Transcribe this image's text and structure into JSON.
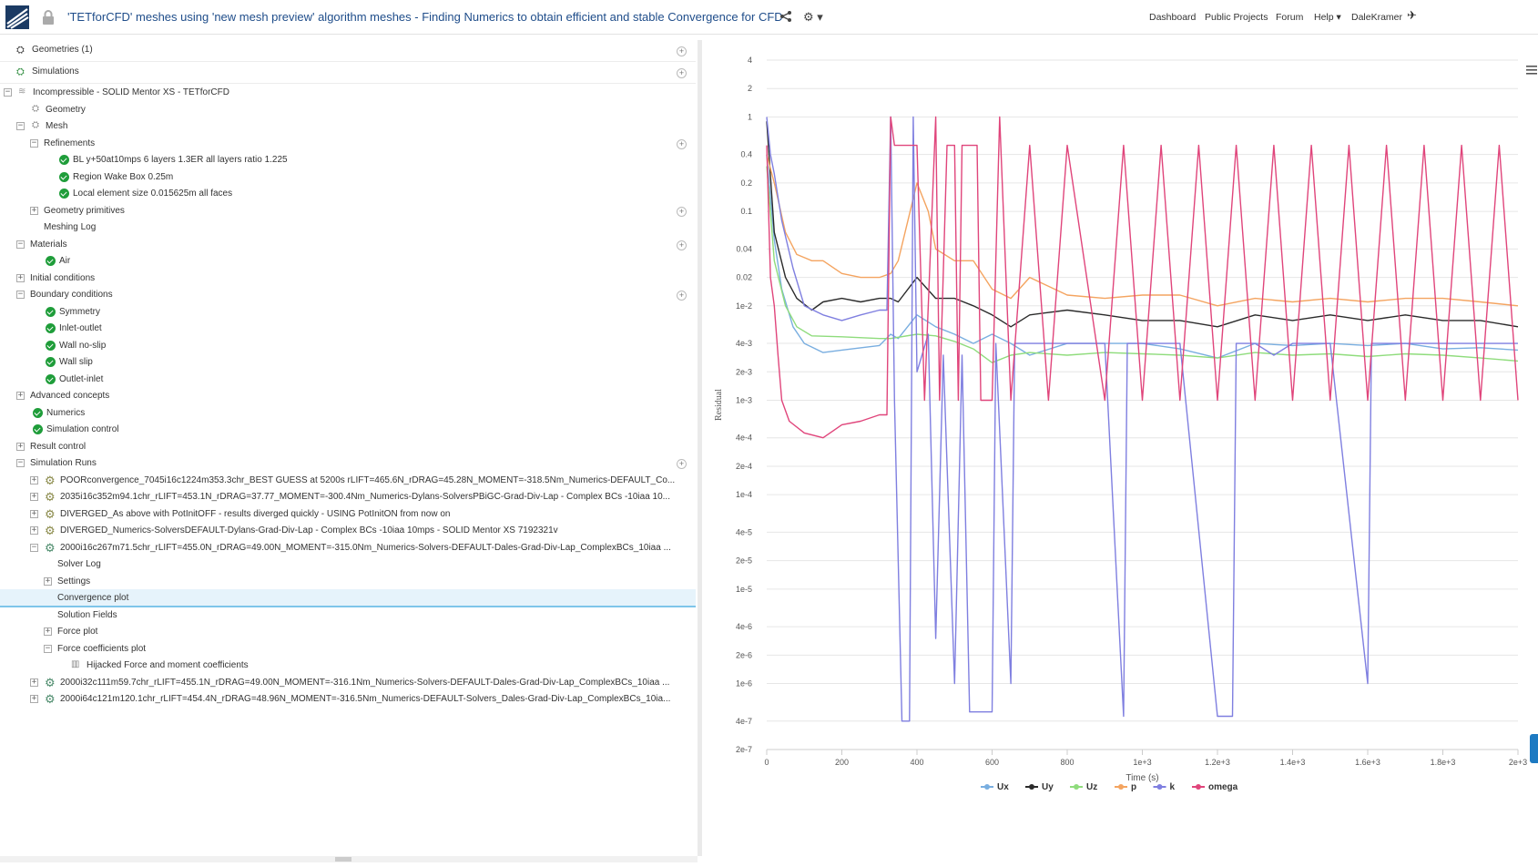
{
  "header": {
    "title": "'TETforCFD' meshes using 'new mesh preview' algorithm meshes - Finding Numerics to obtain efficient and stable Convergence for CFD",
    "nav": [
      "Dashboard",
      "Public Projects",
      "Forum",
      "Help",
      "DaleKramer"
    ]
  },
  "tree": {
    "geometries": "Geometries (1)",
    "simulations": "Simulations",
    "sim_name": "Incompressible - SOLID Mentor XS - TETforCFD",
    "geometry": "Geometry",
    "mesh": "Mesh",
    "refinements": "Refinements",
    "ref1": "BL y+50at10mps 6 layers 1.3ER all layers ratio 1.225",
    "ref2": "Region Wake Box 0.25m",
    "ref3": "Local element size 0.015625m all faces",
    "geom_prims": "Geometry primitives",
    "meshing_log": "Meshing Log",
    "materials": "Materials",
    "air": "Air",
    "initial": "Initial conditions",
    "boundary": "Boundary conditions",
    "bc1": "Symmetry",
    "bc2": "Inlet-outlet",
    "bc3": "Wall no-slip",
    "bc4": "Wall slip",
    "bc5": "Outlet-inlet",
    "advanced": "Advanced concepts",
    "numerics": "Numerics",
    "sim_control": "Simulation control",
    "result_control": "Result control",
    "sim_runs": "Simulation Runs",
    "run1": "POORconvergence_7045i16c1224m353.3chr_BEST GUESS at 5200s rLIFT=465.6N_rDRAG=45.28N_MOMENT=-318.5Nm_Numerics-DEFAULT_Co...",
    "run2": "2035i16c352m94.1chr_rLIFT=453.1N_rDRAG=37.77_MOMENT=-300.4Nm_Numerics-Dylans-SolversPBiGC-Grad-Div-Lap - Complex BCs -10iaa 10...",
    "run3": "DIVERGED_As above with PotInitOFF - results diverged quickly - USING PotInitON from now on",
    "run4": "DIVERGED_Numerics-SolversDEFAULT-Dylans-Grad-Div-Lap - Complex BCs -10iaa 10mps - SOLID Mentor XS 7192321v",
    "run5": "2000i16c267m71.5chr_rLIFT=455.0N_rDRAG=49.00N_MOMENT=-315.0Nm_Numerics-Solvers-DEFAULT-Dales-Grad-Div-Lap_ComplexBCs_10iaa ...",
    "solver_log": "Solver Log",
    "settings": "Settings",
    "conv_plot": "Convergence plot",
    "sol_fields": "Solution Fields",
    "force_plot": "Force plot",
    "force_coef": "Force coefficients plot",
    "hijacked": "Hijacked Force and moment coefficients",
    "run6": "2000i32c111m59.7chr_rLIFT=455.1N_rDRAG=49.00N_MOMENT=-316.1Nm_Numerics-Solvers-DEFAULT-Dales-Grad-Div-Lap_ComplexBCs_10iaa ...",
    "run7": "2000i64c121m120.1chr_rLIFT=454.4N_rDRAG=48.96N_MOMENT=-316.5Nm_Numerics-DEFAULT-Solvers_Dales-Grad-Div-Lap_ComplexBCs_10ia..."
  },
  "colors": {
    "accent": "#1f4d8a",
    "check": "#1f9d3a"
  },
  "chart_data": {
    "type": "line",
    "title": "",
    "xlabel": "Time (s)",
    "ylabel": "Residual",
    "xlim": [
      0,
      2000
    ],
    "ylim": [
      2e-07,
      4
    ],
    "yscale": "log",
    "x_ticks": [
      "0",
      "200",
      "400",
      "600",
      "800",
      "1e+3",
      "1.2e+3",
      "1.4e+3",
      "1.6e+3",
      "1.8e+3",
      "2e+3"
    ],
    "y_ticks": [
      "4",
      "2",
      "1",
      "0.4",
      "0.2",
      "0.1",
      "0.04",
      "0.02",
      "1e-2",
      "4e-3",
      "2e-3",
      "1e-3",
      "4e-4",
      "2e-4",
      "1e-4",
      "4e-5",
      "2e-5",
      "1e-5",
      "4e-6",
      "2e-6",
      "1e-6",
      "4e-7",
      "2e-7"
    ],
    "legend_position": "bottom",
    "series": [
      {
        "name": "Ux",
        "color": "#79aee0",
        "points": [
          [
            0,
            0.4
          ],
          [
            20,
            0.05
          ],
          [
            40,
            0.015
          ],
          [
            70,
            0.006
          ],
          [
            100,
            0.004
          ],
          [
            150,
            0.0032
          ],
          [
            200,
            0.0034
          ],
          [
            300,
            0.0038
          ],
          [
            330,
            0.005
          ],
          [
            350,
            0.0045
          ],
          [
            400,
            0.008
          ],
          [
            450,
            0.006
          ],
          [
            500,
            0.005
          ],
          [
            550,
            0.004
          ],
          [
            600,
            0.005
          ],
          [
            650,
            0.004
          ],
          [
            700,
            0.003
          ],
          [
            800,
            0.004
          ],
          [
            900,
            0.004
          ],
          [
            1000,
            0.004
          ],
          [
            1100,
            0.0035
          ],
          [
            1200,
            0.0028
          ],
          [
            1300,
            0.004
          ],
          [
            1400,
            0.0038
          ],
          [
            1500,
            0.004
          ],
          [
            1600,
            0.0038
          ],
          [
            1700,
            0.004
          ],
          [
            1800,
            0.0035
          ],
          [
            1900,
            0.0036
          ],
          [
            2000,
            0.0034
          ]
        ]
      },
      {
        "name": "Uy",
        "color": "#2b2b2b",
        "points": [
          [
            0,
            0.9
          ],
          [
            20,
            0.06
          ],
          [
            50,
            0.02
          ],
          [
            80,
            0.012
          ],
          [
            120,
            0.009
          ],
          [
            150,
            0.011
          ],
          [
            200,
            0.012
          ],
          [
            250,
            0.011
          ],
          [
            300,
            0.012
          ],
          [
            330,
            0.012
          ],
          [
            350,
            0.011
          ],
          [
            400,
            0.02
          ],
          [
            450,
            0.012
          ],
          [
            500,
            0.012
          ],
          [
            550,
            0.01
          ],
          [
            600,
            0.008
          ],
          [
            650,
            0.006
          ],
          [
            700,
            0.008
          ],
          [
            800,
            0.009
          ],
          [
            900,
            0.008
          ],
          [
            1000,
            0.007
          ],
          [
            1100,
            0.007
          ],
          [
            1200,
            0.006
          ],
          [
            1300,
            0.008
          ],
          [
            1400,
            0.007
          ],
          [
            1500,
            0.008
          ],
          [
            1600,
            0.007
          ],
          [
            1700,
            0.008
          ],
          [
            1800,
            0.007
          ],
          [
            1900,
            0.007
          ],
          [
            2000,
            0.006
          ]
        ]
      },
      {
        "name": "Uz",
        "color": "#8fdc7c",
        "points": [
          [
            0,
            0.3
          ],
          [
            20,
            0.03
          ],
          [
            50,
            0.01
          ],
          [
            80,
            0.006
          ],
          [
            120,
            0.0048
          ],
          [
            200,
            0.0047
          ],
          [
            300,
            0.0045
          ],
          [
            330,
            0.0045
          ],
          [
            400,
            0.005
          ],
          [
            450,
            0.0048
          ],
          [
            500,
            0.0042
          ],
          [
            550,
            0.0035
          ],
          [
            600,
            0.0025
          ],
          [
            650,
            0.003
          ],
          [
            700,
            0.0032
          ],
          [
            800,
            0.003
          ],
          [
            900,
            0.0032
          ],
          [
            1000,
            0.0031
          ],
          [
            1100,
            0.003
          ],
          [
            1200,
            0.0028
          ],
          [
            1300,
            0.0032
          ],
          [
            1400,
            0.003
          ],
          [
            1500,
            0.0031
          ],
          [
            1600,
            0.0029
          ],
          [
            1700,
            0.0031
          ],
          [
            1800,
            0.003
          ],
          [
            1900,
            0.0028
          ],
          [
            2000,
            0.0026
          ]
        ]
      },
      {
        "name": "p",
        "color": "#f4a460",
        "points": [
          [
            0,
            0.4
          ],
          [
            20,
            0.2
          ],
          [
            50,
            0.06
          ],
          [
            80,
            0.035
          ],
          [
            120,
            0.03
          ],
          [
            150,
            0.03
          ],
          [
            200,
            0.022
          ],
          [
            250,
            0.02
          ],
          [
            300,
            0.02
          ],
          [
            330,
            0.022
          ],
          [
            350,
            0.03
          ],
          [
            400,
            0.2
          ],
          [
            430,
            0.1
          ],
          [
            450,
            0.04
          ],
          [
            500,
            0.03
          ],
          [
            550,
            0.03
          ],
          [
            600,
            0.015
          ],
          [
            650,
            0.012
          ],
          [
            700,
            0.02
          ],
          [
            800,
            0.013
          ],
          [
            900,
            0.012
          ],
          [
            1000,
            0.013
          ],
          [
            1100,
            0.013
          ],
          [
            1200,
            0.01
          ],
          [
            1300,
            0.012
          ],
          [
            1400,
            0.011
          ],
          [
            1500,
            0.012
          ],
          [
            1600,
            0.011
          ],
          [
            1700,
            0.012
          ],
          [
            1800,
            0.012
          ],
          [
            1900,
            0.011
          ],
          [
            2000,
            0.01
          ]
        ]
      },
      {
        "name": "k",
        "color": "#7f7fe0",
        "points": [
          [
            0,
            1
          ],
          [
            10,
            0.4
          ],
          [
            20,
            0.25
          ],
          [
            40,
            0.08
          ],
          [
            70,
            0.025
          ],
          [
            100,
            0.01
          ],
          [
            150,
            0.008
          ],
          [
            200,
            0.007
          ],
          [
            250,
            0.008
          ],
          [
            300,
            0.009
          ],
          [
            320,
            0.009
          ],
          [
            330,
            1
          ],
          [
            340,
            0.001
          ],
          [
            360,
            4e-07
          ],
          [
            380,
            4e-07
          ],
          [
            390,
            1
          ],
          [
            400,
            0.002
          ],
          [
            430,
            0.005
          ],
          [
            450,
            3e-06
          ],
          [
            470,
            0.003
          ],
          [
            500,
            1e-06
          ],
          [
            520,
            0.003
          ],
          [
            540,
            5e-07
          ],
          [
            600,
            5e-07
          ],
          [
            610,
            0.004
          ],
          [
            650,
            1e-06
          ],
          [
            660,
            0.004
          ],
          [
            700,
            0.004
          ],
          [
            750,
            0.004
          ],
          [
            800,
            0.004
          ],
          [
            900,
            0.004
          ],
          [
            950,
            4.5e-07
          ],
          [
            960,
            0.004
          ],
          [
            1000,
            0.004
          ],
          [
            1100,
            0.004
          ],
          [
            1200,
            4.5e-07
          ],
          [
            1240,
            4.5e-07
          ],
          [
            1250,
            0.004
          ],
          [
            1300,
            0.004
          ],
          [
            1350,
            0.003
          ],
          [
            1400,
            0.004
          ],
          [
            1500,
            0.004
          ],
          [
            1600,
            1e-06
          ],
          [
            1610,
            0.004
          ],
          [
            1700,
            0.004
          ],
          [
            1800,
            0.004
          ],
          [
            1900,
            0.004
          ],
          [
            2000,
            0.004
          ]
        ]
      },
      {
        "name": "omega",
        "color": "#e0457b",
        "points": [
          [
            0,
            0.5
          ],
          [
            10,
            0.02
          ],
          [
            20,
            0.01
          ],
          [
            30,
            0.003
          ],
          [
            40,
            0.001
          ],
          [
            60,
            0.0006
          ],
          [
            100,
            0.00045
          ],
          [
            150,
            0.0004
          ],
          [
            200,
            0.00055
          ],
          [
            250,
            0.0006
          ],
          [
            300,
            0.0007
          ],
          [
            320,
            0.0007
          ],
          [
            330,
            1
          ],
          [
            340,
            0.5
          ],
          [
            400,
            0.5
          ],
          [
            420,
            0.001
          ],
          [
            450,
            1
          ],
          [
            460,
            0.001
          ],
          [
            480,
            0.5
          ],
          [
            500,
            0.5
          ],
          [
            510,
            0.001
          ],
          [
            520,
            0.5
          ],
          [
            560,
            0.5
          ],
          [
            570,
            0.001
          ],
          [
            600,
            0.001
          ],
          [
            620,
            1
          ],
          [
            650,
            0.001
          ],
          [
            700,
            0.5
          ],
          [
            750,
            0.001
          ],
          [
            800,
            0.5
          ],
          [
            900,
            0.001
          ],
          [
            950,
            0.5
          ],
          [
            1000,
            0.001
          ],
          [
            1050,
            0.5
          ],
          [
            1100,
            0.001
          ],
          [
            1150,
            0.5
          ],
          [
            1200,
            0.001
          ],
          [
            1250,
            0.5
          ],
          [
            1300,
            0.001
          ],
          [
            1350,
            0.5
          ],
          [
            1400,
            0.001
          ],
          [
            1450,
            0.5
          ],
          [
            1500,
            0.001
          ],
          [
            1550,
            0.5
          ],
          [
            1600,
            0.001
          ],
          [
            1650,
            0.5
          ],
          [
            1700,
            0.001
          ],
          [
            1750,
            0.5
          ],
          [
            1800,
            0.001
          ],
          [
            1850,
            0.5
          ],
          [
            1900,
            0.001
          ],
          [
            1950,
            0.5
          ],
          [
            2000,
            0.001
          ]
        ]
      }
    ]
  }
}
